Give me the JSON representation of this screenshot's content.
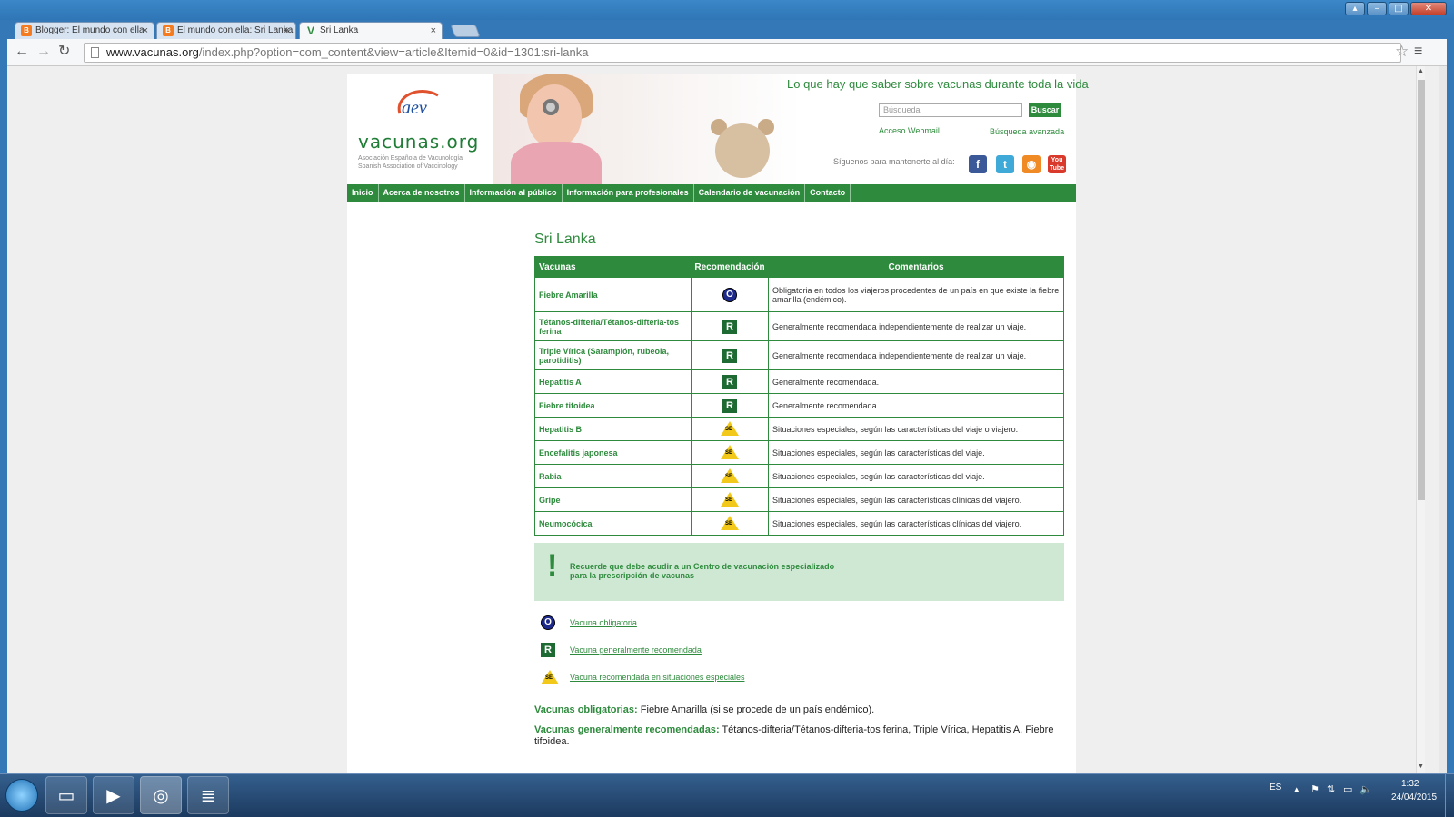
{
  "browser": {
    "tabs": [
      {
        "label": "Blogger: El mundo con ella",
        "icon": "blogger-icon"
      },
      {
        "label": "El mundo con ella: Sri Lanka",
        "icon": "blogger-icon"
      },
      {
        "label": "Sri Lanka",
        "icon": "vacunas-favicon"
      }
    ],
    "url_host": "www.vacunas.org",
    "url_path": "/index.php?option=com_content&view=article&Itemid=0&id=1301:sri-lanka"
  },
  "header": {
    "logo_text": "vacunas.org",
    "logo_sub1": "Asociación Española de Vacunología",
    "logo_sub2": "Spanish Association of Vaccinology",
    "tagline": "Lo que hay que saber sobre vacunas durante toda la vida",
    "search_placeholder": "Búsqueda",
    "search_button": "Buscar",
    "webmail": "Acceso Webmail",
    "advanced_search": "Búsqueda avanzada",
    "follow_text": "Síguenos para mantenerte al día:"
  },
  "nav": [
    "Inicio",
    "Acerca de nosotros",
    "Información al público",
    "Información para profesionales",
    "Calendario de vacunación",
    "Contacto"
  ],
  "page_title": "Sri Lanka",
  "table": {
    "headers": [
      "Vacunas",
      "Recomendación",
      "Comentarios"
    ],
    "rows": [
      {
        "name": "Fiebre Amarilla",
        "rec": "O",
        "comment": "Obligatoria en todos los viajeros procedentes de un país en que existe la fiebre amarilla (endémico)."
      },
      {
        "name": "Tétanos-difteria/Tétanos-difteria-tos ferina",
        "rec": "R",
        "comment": "Generalmente recomendada independientemente de realizar un viaje."
      },
      {
        "name": "Triple Vírica (Sarampión, rubeola, parotiditis)",
        "rec": "R",
        "comment": "Generalmente recomendada independientemente de realizar un viaje."
      },
      {
        "name": "Hepatitis A",
        "rec": "R",
        "comment": "Generalmente recomendada."
      },
      {
        "name": "Fiebre tifoidea",
        "rec": "R",
        "comment": "Generalmente recomendada."
      },
      {
        "name": "Hepatitis B",
        "rec": "SE",
        "comment": "Situaciones especiales, según las características del viaje o viajero."
      },
      {
        "name": "Encefalitis japonesa",
        "rec": "SE",
        "comment": "Situaciones especiales, según las características del viaje."
      },
      {
        "name": "Rabia",
        "rec": "SE",
        "comment": "Situaciones especiales, según las características del viaje."
      },
      {
        "name": "Gripe",
        "rec": "SE",
        "comment": "Situaciones especiales, según las características clínicas del viajero."
      },
      {
        "name": "Neumocócica",
        "rec": "SE",
        "comment": "Situaciones especiales, según las características clínicas del viajero."
      }
    ]
  },
  "notice": {
    "line1": "Recuerde que debe acudir a un Centro de vacunación especializado",
    "line2": "para la prescripción de vacunas"
  },
  "legend": [
    {
      "badge": "O",
      "label": "Vacuna obligatoria"
    },
    {
      "badge": "R",
      "label": "Vacuna generalmente recomendada"
    },
    {
      "badge": "SE",
      "label": "Vacuna recomendada en situaciones especiales"
    }
  ],
  "summary": {
    "mandatory_label": "Vacunas obligatorias",
    "mandatory_text": " Fiebre Amarilla (si se procede de un país endémico).",
    "recommended_label": "Vacunas generalmente recomendadas",
    "recommended_text": " Tétanos-difteria/Tétanos-difteria-tos ferina, Triple Vírica, Hepatitis A, Fiebre tifoidea."
  },
  "taskbar": {
    "lang": "ES",
    "time": "1:32",
    "date": "24/04/2015"
  },
  "colors": {
    "brand_green": "#2e8b3d",
    "mandatory_blue": "#1d2a8c",
    "special_yellow": "#f2c91a"
  }
}
